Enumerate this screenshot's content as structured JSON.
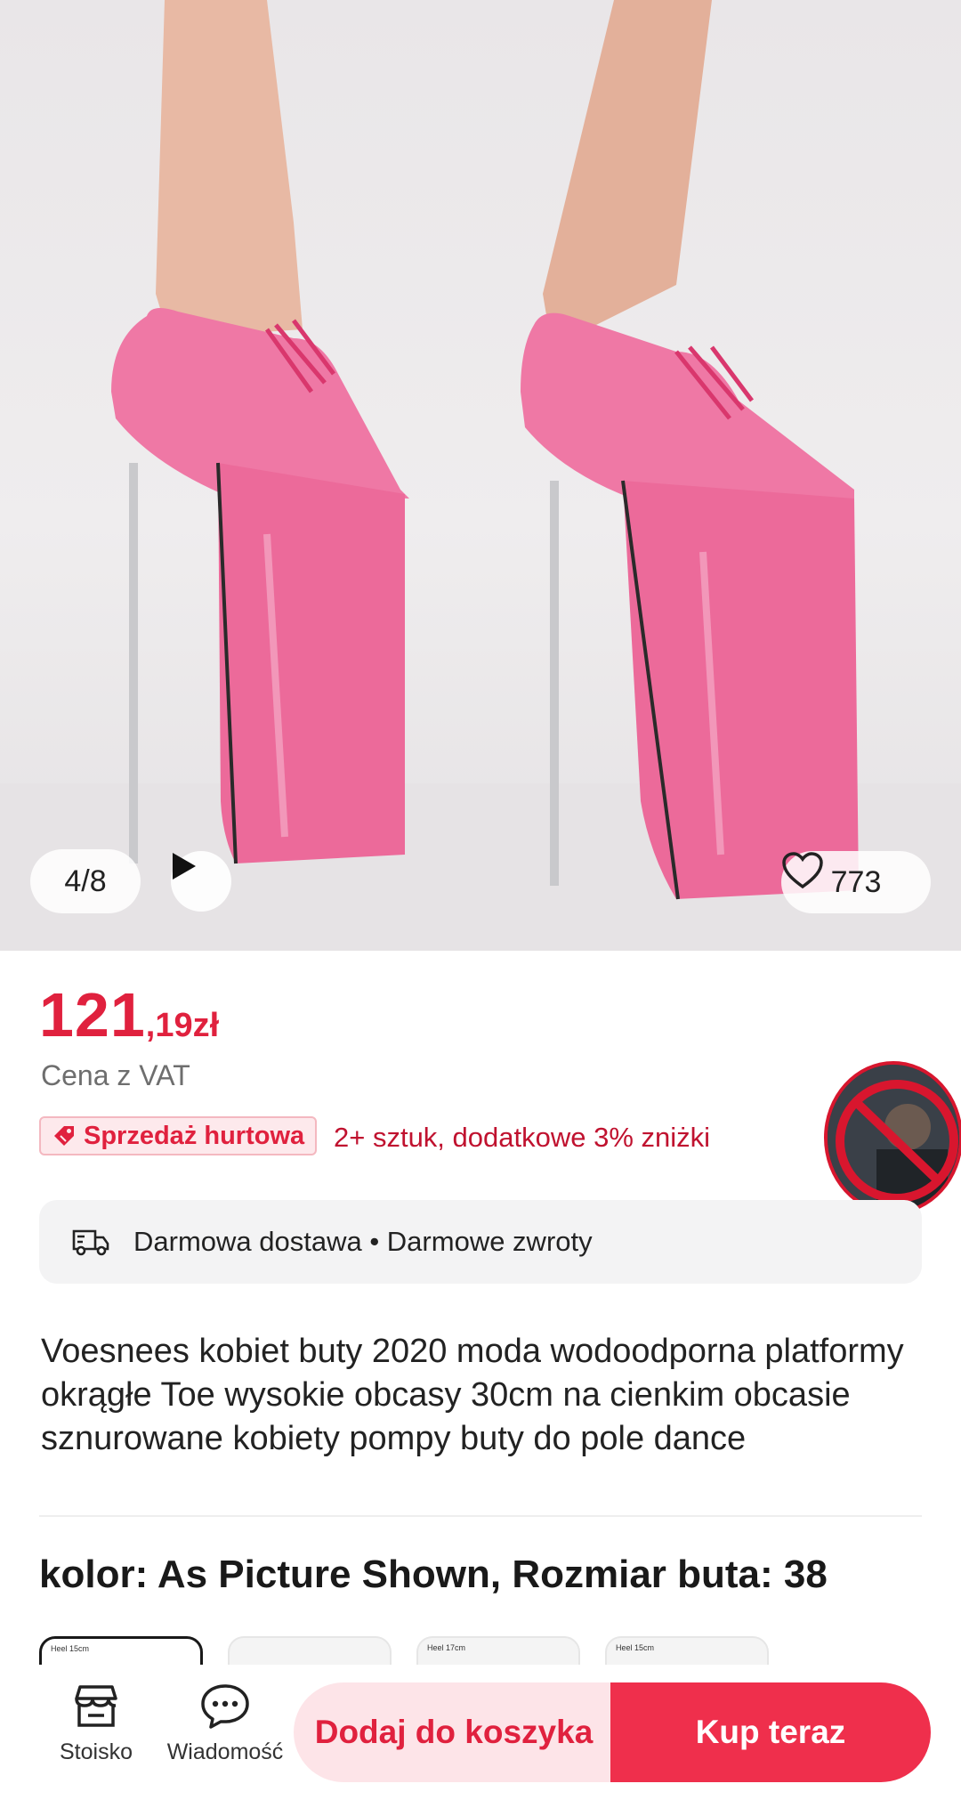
{
  "gallery": {
    "counter": "4/8",
    "likes": "773"
  },
  "price": {
    "integer": "121",
    "decimal": ",19zł",
    "vat_note": "Cena z VAT"
  },
  "wholesale": {
    "badge": "Sprzedaż hurtowa",
    "text": "2+ sztuk, dodatkowe 3% zniżki"
  },
  "delivery": {
    "text": "Darmowa dostawa • Darmowe zwroty"
  },
  "product": {
    "title": "Voesnees kobiet buty 2020 moda wodoodporna platformy okrągłe Toe wysokie obcasy 30cm na cienkim obcasie sznurowane kobiety pompy buty do pole dance"
  },
  "variant": {
    "heading": "kolor: As Picture Shown, Rozmiar buta: 38",
    "thumbs": [
      "Heel 15cm",
      "",
      "Heel 17cm",
      "Heel 15cm"
    ]
  },
  "bottom_bar": {
    "store_label": "Stoisko",
    "message_label": "Wiadomość",
    "add_to_cart": "Dodaj do koszyka",
    "buy_now": "Kup teraz"
  },
  "colors": {
    "accent": "#e0213e",
    "buy_button": "#ef2f4c",
    "cart_button_bg": "#fde4e8",
    "shoe_pink": "#ec6a9a"
  },
  "icons": {
    "play": "play-icon",
    "like": "heart-icon",
    "sale_tag": "tag-icon",
    "delivery": "truck-icon",
    "store": "store-icon",
    "message": "chat-icon"
  }
}
